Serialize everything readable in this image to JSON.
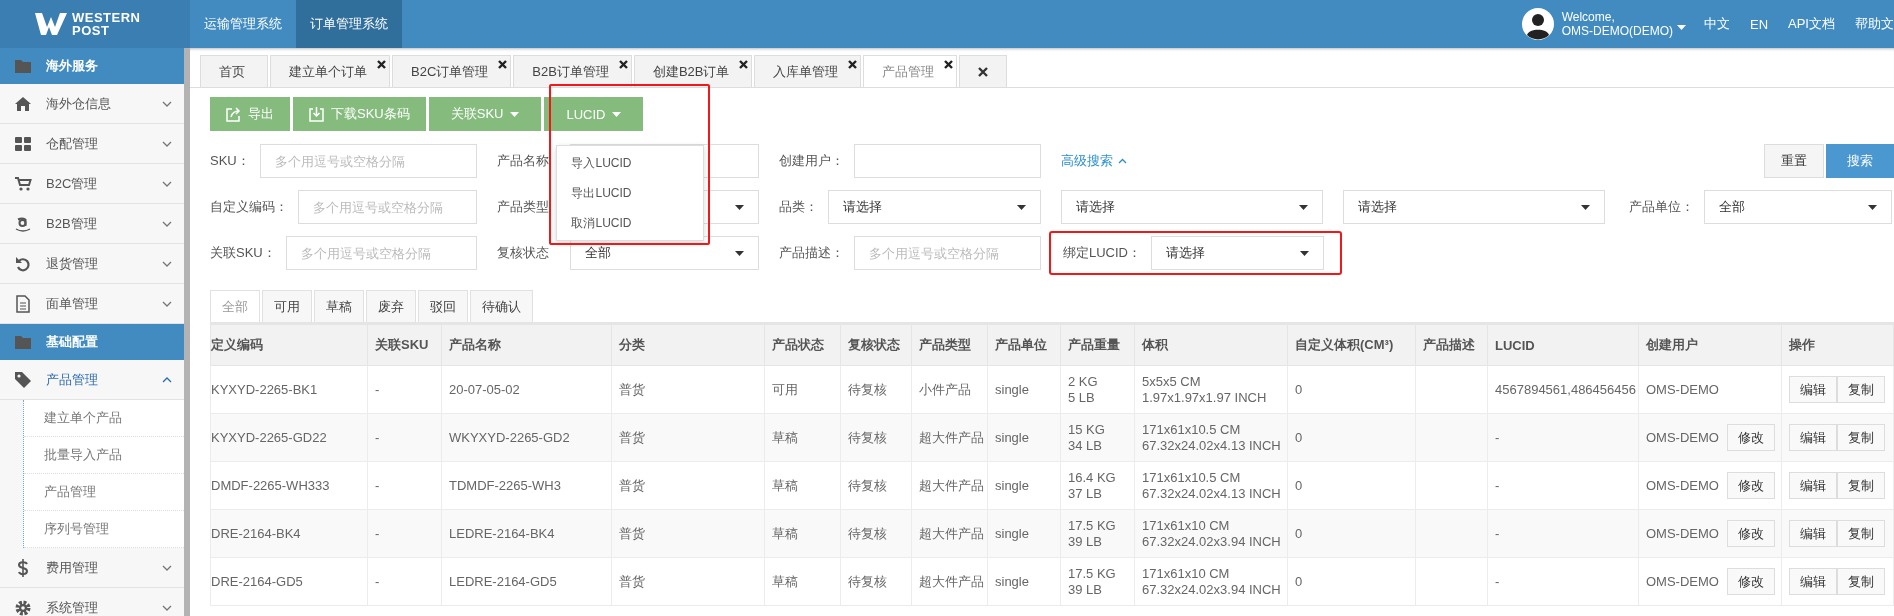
{
  "header": {
    "logo": [
      "WESTERN",
      "POST"
    ],
    "nav": [
      {
        "label": "运输管理系统",
        "selected": false
      },
      {
        "label": "订单管理系统",
        "selected": true
      }
    ],
    "welcome": "Welcome,",
    "user": "OMS-DEMO(DEMO)",
    "links": [
      "中文",
      "EN",
      "API文档",
      "帮助文"
    ]
  },
  "sidebar": {
    "items": [
      {
        "kind": "section",
        "label": "海外服务"
      },
      {
        "kind": "item",
        "label": "海外仓信息",
        "expanded": false
      },
      {
        "kind": "item",
        "label": "仓配管理",
        "expanded": false
      },
      {
        "kind": "item",
        "label": "B2C管理",
        "expanded": false
      },
      {
        "kind": "item",
        "label": "B2B管理",
        "expanded": false
      },
      {
        "kind": "item",
        "label": "退货管理",
        "expanded": false
      },
      {
        "kind": "item",
        "label": "面单管理",
        "expanded": false
      },
      {
        "kind": "section",
        "label": "基础配置"
      },
      {
        "kind": "item",
        "label": "产品管理",
        "expanded": true,
        "children": [
          {
            "label": "建立单个产品"
          },
          {
            "label": "批量导入产品"
          },
          {
            "label": "产品管理"
          },
          {
            "label": "序列号管理"
          }
        ]
      },
      {
        "kind": "item",
        "label": "费用管理",
        "expanded": false
      },
      {
        "kind": "item",
        "label": "系统管理",
        "expanded": false
      }
    ]
  },
  "page_tabs": [
    {
      "label": "首页",
      "selected": false,
      "closable": false
    },
    {
      "label": "建立单个订单",
      "selected": false,
      "closable": true
    },
    {
      "label": "B2C订单管理",
      "selected": false,
      "closable": true
    },
    {
      "label": "B2B订单管理",
      "selected": false,
      "closable": true
    },
    {
      "label": "创建B2B订单",
      "selected": false,
      "closable": true
    },
    {
      "label": "入库单管理",
      "selected": false,
      "closable": true
    },
    {
      "label": "产品管理",
      "selected": true,
      "closable": true
    }
  ],
  "toolbar": {
    "buttons": [
      {
        "kind": "export",
        "label": "导出",
        "highlighted": false
      },
      {
        "kind": "download",
        "label": "下载SKU条码",
        "highlighted": false
      },
      {
        "kind": "dropdown",
        "label": "关联SKU",
        "highlighted": false
      },
      {
        "kind": "dropdown",
        "label": "LUCID",
        "highlighted": true
      }
    ],
    "menu": [
      "导入LUCID",
      "导出LUCID",
      "取消LUCID"
    ]
  },
  "filters": {
    "rows": [
      [
        {
          "kind": "input",
          "label": "SKU：",
          "placeholder": "多个用逗号或空格分隔",
          "highlighted": false
        },
        {
          "kind": "input",
          "label": "产品名称",
          "highlighted": false
        },
        {
          "kind": "input",
          "label": "创建用户：",
          "highlighted": false
        },
        {
          "kind": "link",
          "label": "高级搜索",
          "highlighted": false
        }
      ],
      [
        {
          "kind": "input",
          "label": "自定义编码：",
          "placeholder": "多个用逗号或空格分隔",
          "highlighted": false
        },
        {
          "kind": "select",
          "label": "产品类型",
          "highlighted": false
        },
        {
          "kind": "select",
          "label": "品类：",
          "value": "请选择",
          "highlighted": false
        },
        {
          "kind": "select",
          "value": "请选择",
          "highlighted": false
        },
        {
          "kind": "select",
          "value": "请选择",
          "highlighted": false
        },
        {
          "kind": "select",
          "label": "产品单位：",
          "value": "全部",
          "highlighted": false
        }
      ],
      [
        {
          "kind": "input",
          "label": "关联SKU：",
          "placeholder": "多个用逗号或空格分隔",
          "highlighted": false
        },
        {
          "kind": "select",
          "label": "复核状态",
          "value": "全部",
          "highlighted": false
        },
        {
          "kind": "input",
          "label": "产品描述：",
          "placeholder": "多个用逗号或空格分隔",
          "highlighted": false
        },
        {
          "kind": "select",
          "label": "绑定LUCID：",
          "value": "请选择",
          "highlighted": true
        }
      ]
    ],
    "actions": [
      {
        "kind": "plain",
        "label": "重置"
      },
      {
        "kind": "primary",
        "label": "搜索"
      }
    ]
  },
  "status_tabs": [
    {
      "label": "全部",
      "selected": true
    },
    {
      "label": "可用",
      "selected": false
    },
    {
      "label": "草稿",
      "selected": false
    },
    {
      "label": "废弃",
      "selected": false
    },
    {
      "label": "驳回",
      "selected": false
    },
    {
      "label": "待确认",
      "selected": false
    }
  ],
  "table": {
    "columns": [
      "定义编码",
      "关联SKU",
      "产品名称",
      "分类",
      "产品状态",
      "复核状态",
      "产品类型",
      "产品单位",
      "产品重量",
      "体积",
      "自定义体积(CM³)",
      "产品描述",
      "LUCID",
      "创建用户",
      "操作"
    ],
    "rows": [
      {
        "code": "KYXYD-2265-BK1",
        "related_sku": "-",
        "name": "20-07-05-02",
        "category": "普货",
        "status": "可用",
        "review": "待复核",
        "type": "小件产品",
        "unit": "single",
        "weight": [
          "2 KG",
          "5 LB"
        ],
        "volume": [
          "5x5x5 CM",
          "1.97x1.97x1.97 INCH"
        ],
        "custom_volume": "0",
        "lucid": "4567894561,486456456",
        "user": "OMS-DEMO",
        "actions": [
          "编辑",
          "复制"
        ]
      },
      {
        "code": "KYXYD-2265-GD22",
        "related_sku": "-",
        "name": "WKYXYD-2265-GD2",
        "category": "普货",
        "status": "草稿",
        "review": "待复核",
        "type": "超大件产品",
        "unit": "single",
        "weight": [
          "15 KG",
          "34 LB"
        ],
        "volume": [
          "171x61x10.5 CM",
          "67.32x24.02x4.13 INCH"
        ],
        "custom_volume": "0",
        "lucid": "-",
        "user": "OMS-DEMO",
        "modify": "修改",
        "actions": [
          "编辑",
          "复制"
        ]
      },
      {
        "code": "DMDF-2265-WH333",
        "related_sku": "-",
        "name": "TDMDF-2265-WH3",
        "category": "普货",
        "status": "草稿",
        "review": "待复核",
        "type": "超大件产品",
        "unit": "single",
        "weight": [
          "16.4 KG",
          "37 LB"
        ],
        "volume": [
          "171x61x10.5 CM",
          "67.32x24.02x4.13 INCH"
        ],
        "custom_volume": "0",
        "lucid": "-",
        "user": "OMS-DEMO",
        "modify": "修改",
        "actions": [
          "编辑",
          "复制"
        ]
      },
      {
        "code": "DRE-2164-BK4",
        "related_sku": "-",
        "name": "LEDRE-2164-BK4",
        "category": "普货",
        "status": "草稿",
        "review": "待复核",
        "type": "超大件产品",
        "unit": "single",
        "weight": [
          "17.5 KG",
          "39 LB"
        ],
        "volume": [
          "171x61x10 CM",
          "67.32x24.02x3.94 INCH"
        ],
        "custom_volume": "0",
        "lucid": "-",
        "user": "OMS-DEMO",
        "modify": "修改",
        "actions": [
          "编辑",
          "复制"
        ]
      },
      {
        "code": "DRE-2164-GD5",
        "related_sku": "-",
        "name": "LEDRE-2164-GD5",
        "category": "普货",
        "status": "草稿",
        "review": "待复核",
        "type": "超大件产品",
        "unit": "single",
        "weight": [
          "17.5 KG",
          "39 LB"
        ],
        "volume": [
          "171x61x10 CM",
          "67.32x24.02x3.94 INCH"
        ],
        "custom_volume": "0",
        "lucid": "-",
        "user": "OMS-DEMO",
        "modify": "修改",
        "actions": [
          "编辑",
          "复制"
        ]
      }
    ]
  }
}
